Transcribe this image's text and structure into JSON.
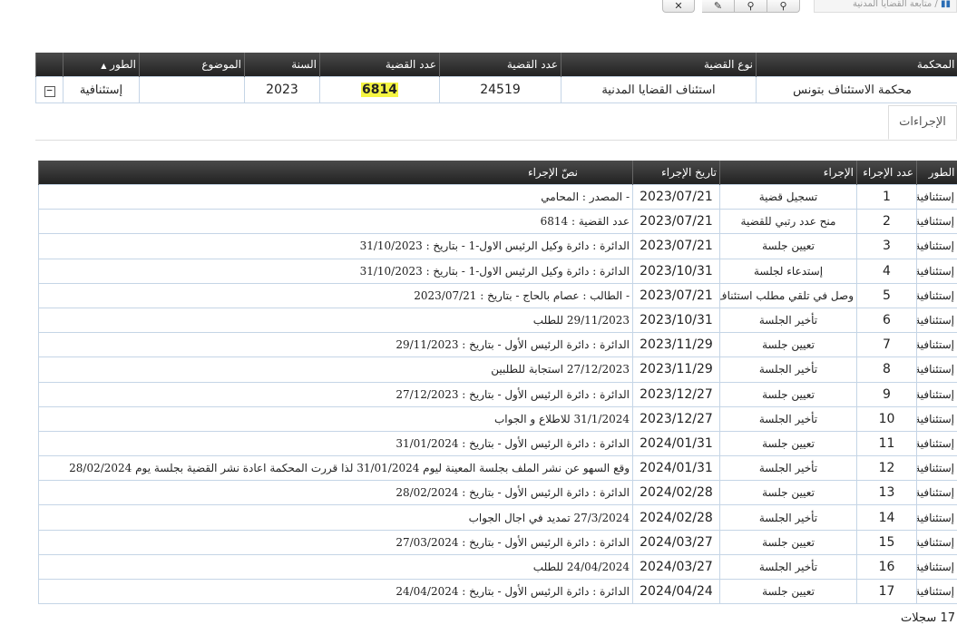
{
  "toolbar": {
    "breadcrumb": "متابعة القضايا المدنية",
    "breadcrumb_sep": "/"
  },
  "case_table": {
    "headers": [
      "المحكمة",
      "نوع القضية",
      "عدد القضية",
      "عدد القضية",
      "السنة",
      "الموضوع",
      "الطور"
    ],
    "row": {
      "court": "محكمة الاستئناف بتونس",
      "case_type": "استئناف القضايا المدنية",
      "case_number": "24519",
      "case_number_2": "6814",
      "year": "2023",
      "subject": "",
      "phase": "إستئنافية"
    }
  },
  "tabs": [
    {
      "label": "الإجراءات"
    }
  ],
  "procedures_table": {
    "headers": [
      "الطور",
      "عدد الإجراء",
      "الإجراء",
      "تاريخ الإجراء",
      "نصّ الإجراء"
    ],
    "rows": [
      {
        "phase": "إستئنافية",
        "num": "1",
        "action": "تسجيل قضية",
        "date": "2023/07/21",
        "text": "- المصدر : المحامي"
      },
      {
        "phase": "إستئنافية",
        "num": "2",
        "action": "منح عدد رتبي للقضية",
        "date": "2023/07/21",
        "text": "عدد القضية : 6814"
      },
      {
        "phase": "إستئنافية",
        "num": "3",
        "action": "تعيين جلسة",
        "date": "2023/07/21",
        "text": "الدائرة : دائرة وكيل الرئيس الاول-1 - بتاريخ : 31/10/2023"
      },
      {
        "phase": "إستئنافية",
        "num": "4",
        "action": "إستدعاء لجلسة",
        "date": "2023/10/31",
        "text": "الدائرة : دائرة وكيل الرئيس الاول-1 - بتاريخ : 31/10/2023"
      },
      {
        "phase": "إستئنافية",
        "num": "5",
        "action": "وصل في تلقي مطلب استئناف",
        "date": "2023/07/21",
        "text": "- الطالب : عصام بالحاج - بتاريخ : 2023/07/21"
      },
      {
        "phase": "إستئنافية",
        "num": "6",
        "action": "تأخير الجلسة",
        "date": "2023/10/31",
        "text": "29/11/2023 للطلب"
      },
      {
        "phase": "إستئنافية",
        "num": "7",
        "action": "تعيين جلسة",
        "date": "2023/11/29",
        "text": "الدائرة : دائرة الرئيس الأول - بتاريخ : 29/11/2023"
      },
      {
        "phase": "إستئنافية",
        "num": "8",
        "action": "تأخير الجلسة",
        "date": "2023/11/29",
        "text": "27/12/2023 استجابة للطلبين"
      },
      {
        "phase": "إستئنافية",
        "num": "9",
        "action": "تعيين جلسة",
        "date": "2023/12/27",
        "text": "الدائرة : دائرة الرئيس الأول - بتاريخ : 27/12/2023"
      },
      {
        "phase": "إستئنافية",
        "num": "10",
        "action": "تأخير الجلسة",
        "date": "2023/12/27",
        "text": "31/1/2024 للاطلاع و الجواب"
      },
      {
        "phase": "إستئنافية",
        "num": "11",
        "action": "تعيين جلسة",
        "date": "2024/01/31",
        "text": "الدائرة : دائرة الرئيس الأول - بتاريخ : 31/01/2024"
      },
      {
        "phase": "إستئنافية",
        "num": "12",
        "action": "تأخير الجلسة",
        "date": "2024/01/31",
        "text": "وقع السهو عن نشر الملف بجلسة المعينة ليوم 31/01/2024 لذا قررت المحكمة اعادة نشر القضية بجلسة يوم 28/02/2024"
      },
      {
        "phase": "إستئنافية",
        "num": "13",
        "action": "تعيين جلسة",
        "date": "2024/02/28",
        "text": "الدائرة : دائرة الرئيس الأول - بتاريخ : 28/02/2024"
      },
      {
        "phase": "إستئنافية",
        "num": "14",
        "action": "تأخير الجلسة",
        "date": "2024/02/28",
        "text": "27/3/2024 تمديد في اجال الجواب"
      },
      {
        "phase": "إستئنافية",
        "num": "15",
        "action": "تعيين جلسة",
        "date": "2024/03/27",
        "text": "الدائرة : دائرة الرئيس الأول - بتاريخ : 27/03/2024"
      },
      {
        "phase": "إستئنافية",
        "num": "16",
        "action": "تأخير الجلسة",
        "date": "2024/03/27",
        "text": "24/04/2024 للطلب"
      },
      {
        "phase": "إستئنافية",
        "num": "17",
        "action": "تعيين جلسة",
        "date": "2024/04/24",
        "text": "الدائرة : دائرة الرئيس الأول - بتاريخ : 24/04/2024"
      }
    ]
  },
  "footer": {
    "records": "17 سجلات"
  }
}
